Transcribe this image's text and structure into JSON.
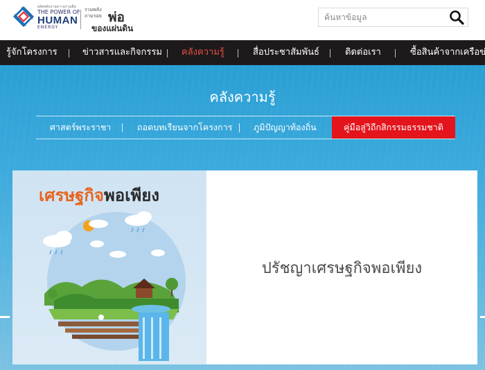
{
  "header": {
    "logo_small": "ผลิตพลังงานความร่วมมือ",
    "logo_the": "THE POWER OF",
    "logo_human": "HUMAN",
    "logo_energy": "ENERGY",
    "slogan_small_1": "รวมพลัง",
    "slogan_small_2": "ถามรอย",
    "slogan_big": "พ่อ",
    "slogan_sub": "ของแผ่นดิน"
  },
  "search": {
    "placeholder": "ค้นหาข้อมูล"
  },
  "nav": {
    "items": [
      {
        "label": "รู้จักโครงการ"
      },
      {
        "label": "ข่าวสารและกิจกรรม"
      },
      {
        "label": "คลังความรู้"
      },
      {
        "label": "สื่อประชาสัมพันธ์"
      },
      {
        "label": "ติดต่อเรา"
      },
      {
        "label": "ซื้อสินค้าจากเครือข่าย"
      }
    ],
    "active_index": 2
  },
  "hero": {
    "title": "คลังความรู้",
    "subnav": [
      {
        "label": "ศาสตร์พระราชา"
      },
      {
        "label": "ถอดบทเรียนจากโครงการ"
      },
      {
        "label": "ภูมิปัญญาท้องถิ่น"
      },
      {
        "label": "คู่มือสู่วิถีกสิกรรมธรรมชาติ"
      }
    ]
  },
  "card": {
    "image_title_1": "เศรษฐกิจ",
    "image_title_2": "พอเพียง",
    "title": "ปรัชญาเศรษฐกิจพอเพียง"
  },
  "colors": {
    "nav_bg": "#1e1a1c",
    "nav_active": "#e24e44",
    "subnav_active_bg": "#e3141c",
    "hero_blue": "#2a9fd4",
    "card_title_orange": "#e8641e"
  }
}
